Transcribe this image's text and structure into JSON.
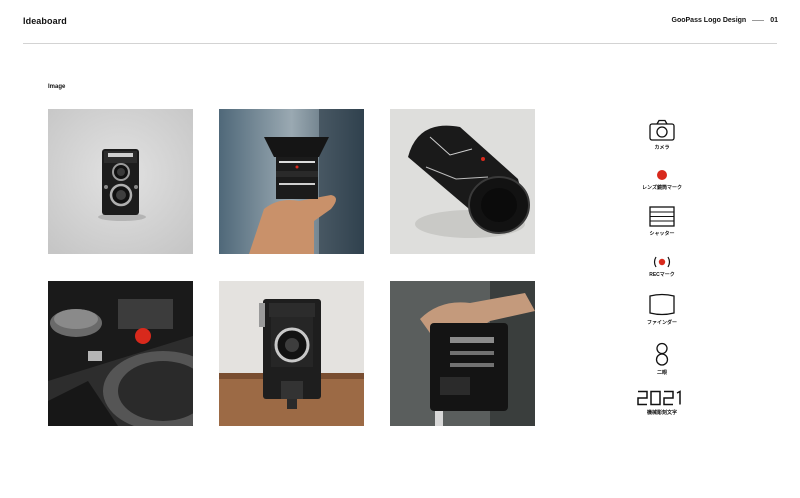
{
  "header": {
    "app_title": "Ideaboard",
    "project_title": "GooPass Logo Design",
    "page_number": "01"
  },
  "section": {
    "label": "Image"
  },
  "gallery": {
    "images": [
      {
        "subject": "twin-lens-reflex-camera",
        "background": "#cfcfcf"
      },
      {
        "subject": "hand-holding-lens",
        "background": "#5f7484"
      },
      {
        "subject": "camera-lens",
        "background": "#d9d9d7"
      },
      {
        "subject": "rangefinder-camera-closeup",
        "background": "#3a3a3a"
      },
      {
        "subject": "folding-camera-on-table",
        "background": "#a6795a"
      },
      {
        "subject": "hand-holding-camera",
        "background": "#4b4f4f"
      }
    ]
  },
  "icons": [
    {
      "icon": "camera-icon",
      "label": "カメラ"
    },
    {
      "icon": "red-dot-icon",
      "label": "レンズ鏡筒マーク",
      "color": "#d8291c"
    },
    {
      "icon": "shutter-icon",
      "label": "シャッター"
    },
    {
      "icon": "rec-mark-icon",
      "label": "RECマーク",
      "color": "#d8291c"
    },
    {
      "icon": "finder-icon",
      "label": "ファインダー"
    },
    {
      "icon": "lens-pair-icon",
      "label": "二眼"
    },
    {
      "icon": "digits-2021-icon",
      "label": "機械彫刻文字",
      "glyph_text": "2021"
    }
  ]
}
